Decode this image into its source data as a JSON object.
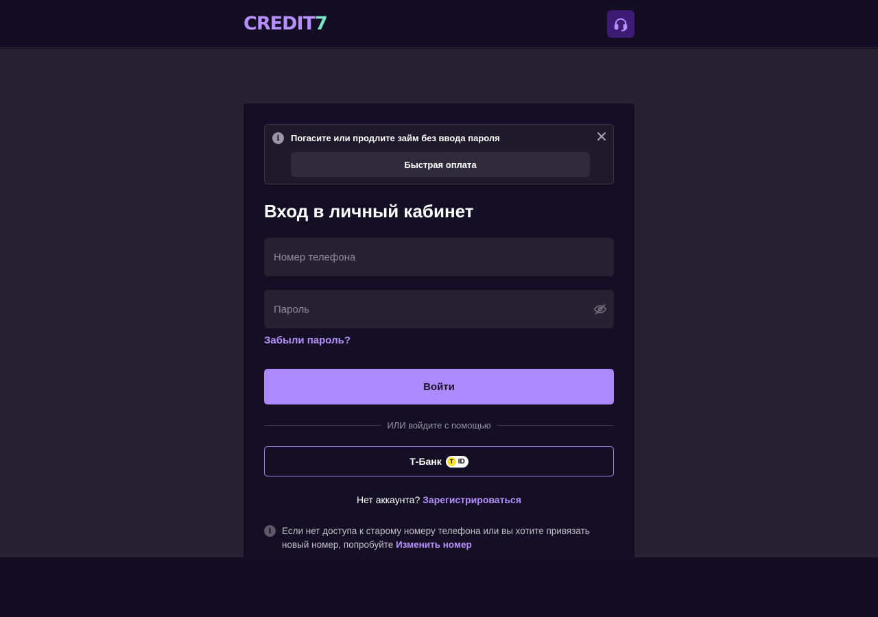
{
  "header": {
    "logo_main": "CREDIT",
    "logo_num": "7",
    "support_icon": "headset-icon"
  },
  "notice": {
    "text": "Погасите или продлите займ без ввода пароля",
    "button_label": "Быстрая оплата",
    "info_icon": "info-icon",
    "close_icon": "close-icon"
  },
  "form": {
    "title": "Вход в личный кабинет",
    "phone_placeholder": "Номер телефона",
    "password_placeholder": "Пароль",
    "forgot_label": "Забыли пароль?",
    "login_label": "Войти",
    "divider_text": "ИЛИ войдите с помощью",
    "tbank_label": "Т-Банк",
    "tid_t": "T",
    "tid_label": "ID",
    "no_account_text": "Нет аккаунта?",
    "register_label": "Зарегистрироваться",
    "info_text": "Если нет доступа к старому номеру телефона или вы хотите привязать новый номер, попробуйте",
    "change_number_label": "Изменить номер"
  },
  "colors": {
    "accent": "#b690ff",
    "button": "#ad8aff",
    "logo_num": "#7ae6c8",
    "background": "#262232"
  }
}
